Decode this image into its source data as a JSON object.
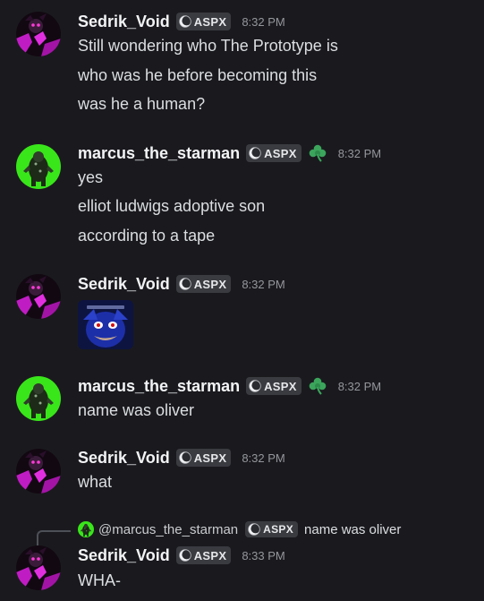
{
  "messages": [
    {
      "username": "Sedrik_Void",
      "tag": "ASPX",
      "time": "8:32 PM",
      "lines": [
        "Still wondering who The Prototype is",
        "who was he before becoming this",
        "was he a human?"
      ]
    },
    {
      "username": "marcus_the_starman",
      "tag": "ASPX",
      "time": "8:32 PM",
      "role_icon": "clover-icon",
      "lines": [
        "yes",
        "elliot ludwigs adoptive son",
        "according to a tape"
      ]
    },
    {
      "username": "Sedrik_Void",
      "tag": "ASPX",
      "time": "8:32 PM",
      "attachment": "image-attachment"
    },
    {
      "username": "marcus_the_starman",
      "tag": "ASPX",
      "time": "8:32 PM",
      "role_icon": "clover-icon",
      "lines": [
        "name was oliver"
      ]
    },
    {
      "username": "Sedrik_Void",
      "tag": "ASPX",
      "time": "8:32 PM",
      "lines": [
        "what"
      ]
    },
    {
      "reply": {
        "username": "@marcus_the_starman",
        "tag": "ASPX",
        "text": "name was oliver"
      },
      "username": "Sedrik_Void",
      "tag": "ASPX",
      "time": "8:33 PM",
      "lines": [
        "WHA-"
      ]
    }
  ],
  "colors": {
    "background": "#1a1a1e",
    "username": "#f2f3f5",
    "text": "#dbdee1",
    "timestamp": "#94969c",
    "tag_bg": "#3a3b41",
    "clover": "#3ba55c",
    "avatar_sedrik": "#c01cc4",
    "avatar_marcus": "#39e61a"
  }
}
